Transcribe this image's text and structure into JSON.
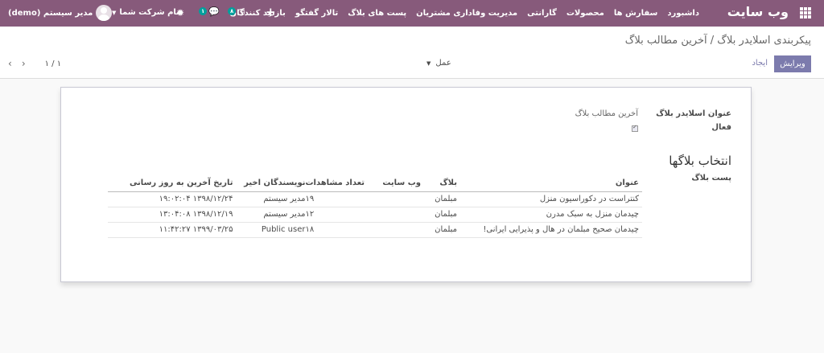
{
  "topnav": {
    "brand": "وب سایت",
    "menu": [
      "داشبورد",
      "سفارش ها",
      "محصولات",
      "گارانتی",
      "مدیریت وفاداری مشتریان",
      "پست های بلاگ",
      "تالار گفتگو",
      "بازدید کنندگان"
    ],
    "user_label": "مدیر سیستم (demo)",
    "company_label": "نام شرکت شما",
    "chat_badge": "۱",
    "activity_badge": "۸"
  },
  "control": {
    "breadcrumb": "پیکربندی اسلایدر بلاگ / آخرین مطالب بلاگ",
    "edit_label": "ویرایش",
    "create_label": "ایجاد",
    "action_label": "عمل",
    "pager_counter": "۱ / ۱"
  },
  "form": {
    "title_label": "عنوان اسلایدر بلاگ",
    "title_value": "آخرین مطالب بلاگ",
    "active_label": "فعال",
    "active_checked": true,
    "section_title": "انتخاب بلاگها",
    "post_label": "پست بلاگ",
    "table": {
      "headers": [
        "عنوان",
        "بلاگ",
        "وب سایت",
        "تعداد مشاهدات",
        "نویسندگان اخیر",
        "تاریخ آخرین به روز رسانی"
      ],
      "rows": [
        {
          "title": "کنتراست در دکوراسیون منزل",
          "blog": "مبلمان",
          "website": "",
          "views": "۱۹",
          "author": "مدیر سیستم",
          "updated": "۱۳۹۸/۱۲/۲۴ ۱۹:۰۲:۰۴"
        },
        {
          "title": "چیدمان منزل به سبک مدرن",
          "blog": "مبلمان",
          "website": "",
          "views": "۱۲",
          "author": "مدیر سیستم",
          "updated": "۱۳۹۸/۱۲/۱۹ ۱۳:۰۴:۰۸"
        },
        {
          "title": "چیدمان صحیح مبلمان در هال و پذیرایی ایرانی!",
          "blog": "مبلمان",
          "website": "",
          "views": "۱۸",
          "author": "Public user",
          "updated": "۱۳۹۹/۰۳/۲۵ ۱۱:۴۲:۲۷"
        }
      ]
    }
  }
}
